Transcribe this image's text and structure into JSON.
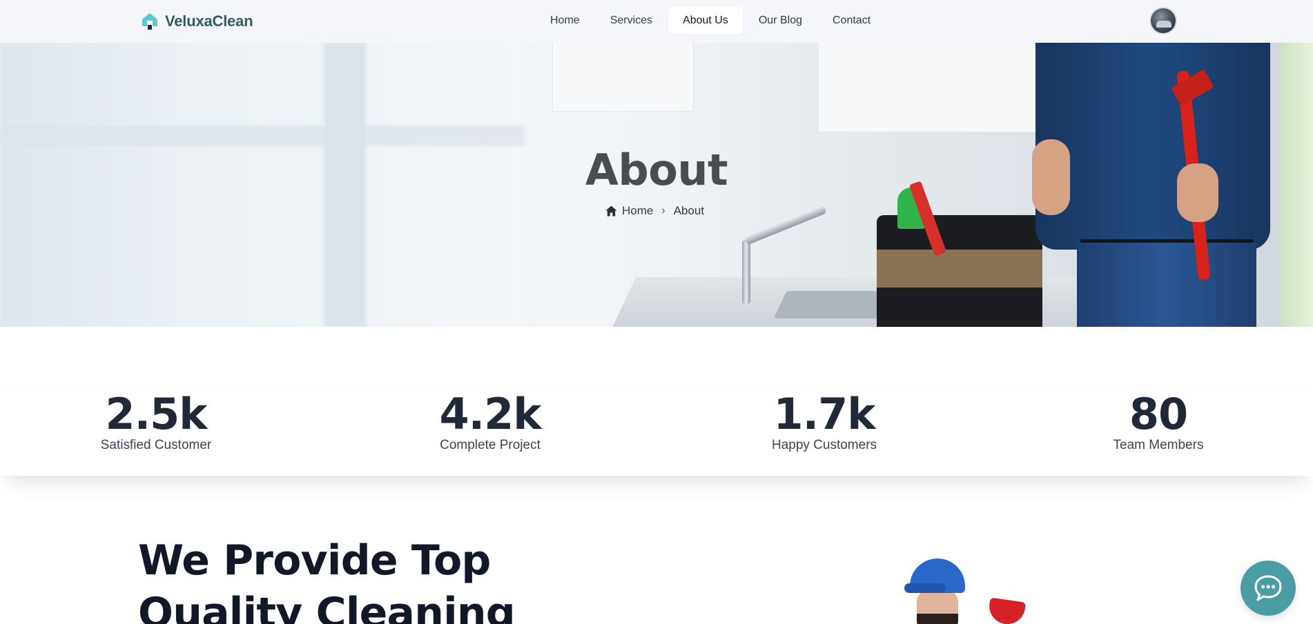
{
  "brand": {
    "name": "VeluxaClean",
    "accent": "#2f5d62",
    "icon": "house-logo-icon"
  },
  "nav": {
    "items": [
      {
        "label": "Home",
        "active": false
      },
      {
        "label": "Services",
        "active": false
      },
      {
        "label": "About Us",
        "active": true
      },
      {
        "label": "Our Blog",
        "active": false
      },
      {
        "label": "Contact",
        "active": false
      }
    ]
  },
  "user": {
    "avatar": "user-avatar"
  },
  "hero": {
    "title": "About",
    "breadcrumb": {
      "home": "Home",
      "separator": "›",
      "current": "About"
    }
  },
  "stats": [
    {
      "value": "2.5k",
      "label": "Satisfied Customer"
    },
    {
      "value": "4.2k",
      "label": "Complete Project"
    },
    {
      "value": "1.7k",
      "label": "Happy Customers"
    },
    {
      "value": "80",
      "label": "Team Members"
    }
  ],
  "section": {
    "title": "We Provide Top Quality Cleaning"
  },
  "chat": {
    "icon": "chat-bubble-icon",
    "color": "#4a9ea3"
  }
}
